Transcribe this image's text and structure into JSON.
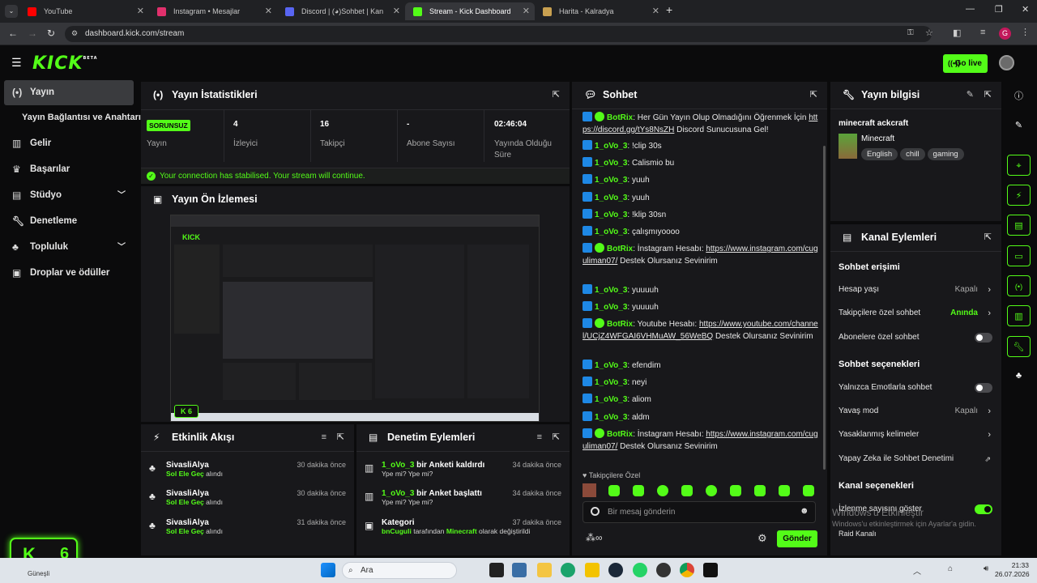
{
  "browser": {
    "tabs": [
      {
        "label": "YouTube",
        "color": "#ff0000"
      },
      {
        "label": "Instagram • Mesajlar",
        "color": "#e1306c"
      },
      {
        "label": "Discord | (◕)Sohbet | Kan",
        "color": "#5865f2"
      },
      {
        "label": "Stream - Kick Dashboard",
        "color": "#53fc18"
      },
      {
        "label": "Harita - Kalradya",
        "color": "#c8a050"
      }
    ],
    "url": "dashboard.kick.com/stream",
    "profile_letter": "G"
  },
  "header": {
    "logo": "KICK",
    "logo_sup": "BETA",
    "go_live": "Go live"
  },
  "sidebar": {
    "items": [
      {
        "label": "Yayın",
        "icon": "broadcast-icon"
      },
      {
        "label": "Yayın Bağlantısı ve Anahtarı",
        "icon": ""
      },
      {
        "label": "Gelir",
        "icon": "chart-icon"
      },
      {
        "label": "Başarılar",
        "icon": "trophy-icon"
      },
      {
        "label": "Stüdyo",
        "icon": "studio-icon"
      },
      {
        "label": "Denetleme",
        "icon": "wrench-icon"
      },
      {
        "label": "Topluluk",
        "icon": "community-icon"
      },
      {
        "label": "Droplar ve ödüller",
        "icon": "gift-icon"
      }
    ],
    "kick_badge_count": "6"
  },
  "stats": {
    "title": "Yayın İstatistikleri",
    "status_badge": "SORUNSUZ",
    "status_label": "Yayın",
    "items": [
      {
        "value": "4",
        "label": "İzleyici"
      },
      {
        "value": "16",
        "label": "Takipçi"
      },
      {
        "value": "-",
        "label": "Abone Sayısı"
      },
      {
        "value": "02:46:04",
        "label": "Yayında Olduğu Süre"
      }
    ],
    "notice": "Your connection has stabilised. Your stream will continue."
  },
  "preview": {
    "title": "Yayın Ön İzlemesi",
    "viewers": "6"
  },
  "activity": {
    "title": "Etkinlik Akışı",
    "items": [
      {
        "name": "SivasliAlya",
        "sub": "Sol Ele Geç",
        "suffix": "alındı",
        "time": "30 dakika önce"
      },
      {
        "name": "SivasliAlya",
        "sub": "Sol Ele Geç",
        "suffix": "alındı",
        "time": "30 dakika önce"
      },
      {
        "name": "SivasliAlya",
        "sub": "Sol Ele Geç",
        "suffix": "alındı",
        "time": "31 dakika önce"
      }
    ]
  },
  "moderation": {
    "title": "Denetim Eylemleri",
    "items": [
      {
        "user": "1_oVo_3",
        "action": "bir Anketi kaldırdı",
        "detail": "Ype mi? Ype mi?",
        "time": "34 dakika önce"
      },
      {
        "user": "1_oVo_3",
        "action": "bir Anket başlattı",
        "detail": "Ype mi? Ype mi?",
        "time": "34 dakika önce"
      },
      {
        "user": "Kategori",
        "action": "",
        "detail_user": "bnCuguli",
        "detail_mid": "tarafından",
        "detail_game": "Minecraft",
        "detail_end": "olarak değiştirildi",
        "time": "37 dakika önce"
      }
    ]
  },
  "chat": {
    "title": "Sohbet",
    "messages": [
      {
        "user": "BotRix",
        "verified": true,
        "text": "Her Gün Yayın Olup Olmadığını Öğrenmek İçin",
        "link": "https://discord.gg/tYs8NsZH",
        "after": "Discord Sunucusuna Gel!"
      },
      {
        "user": "1_oVo_3",
        "text": "!clip 30s"
      },
      {
        "user": "1_oVo_3",
        "text": "Calismio bu"
      },
      {
        "user": "1_oVo_3",
        "text": "yuuh"
      },
      {
        "user": "1_oVo_3",
        "text": "yuuh"
      },
      {
        "user": "1_oVo_3",
        "text": "!klip 30sn"
      },
      {
        "user": "1_oVo_3",
        "text": "çalışmıyoooo"
      },
      {
        "user": "BotRix",
        "verified": true,
        "text": "İnstagram Hesabı:",
        "link": "https://www.instagram.com/cuguliman07/",
        "after": "Destek Olursanız Sevinirim"
      },
      {
        "user": "1_oVo_3",
        "text": "yuuuuh"
      },
      {
        "user": "1_oVo_3",
        "text": "yuuuuh"
      },
      {
        "user": "BotRix",
        "verified": true,
        "text": "Youtube Hesabı:",
        "link": "https://www.youtube.com/channel/UCjZ4WFGAI6VHMuAW_56WeBQ",
        "after": "Destek Olursanız Sevinirim"
      },
      {
        "user": "1_oVo_3",
        "text": "efendim"
      },
      {
        "user": "1_oVo_3",
        "text": "neyi"
      },
      {
        "user": "1_oVo_3",
        "text": "aliom"
      },
      {
        "user": "1_oVo_3",
        "text": "aldm"
      },
      {
        "user": "BotRix",
        "verified": true,
        "text": "İnstagram Hesabı:",
        "link": "https://www.instagram.com/cuguliman07/",
        "after": "Destek Olursanız Sevinirim"
      }
    ],
    "followers_only": "Takipçilere Özel",
    "input_placeholder": "Bir mesaj gönderin",
    "send": "Gönder"
  },
  "stream_info": {
    "title": "Yayın bilgisi",
    "stream_title": "minecraft ackcraft",
    "category": "Minecraft",
    "tags": [
      "English",
      "chill",
      "gaming"
    ]
  },
  "channel_actions": {
    "title": "Kanal Eylemleri",
    "chat_access_title": "Sohbet erişimi",
    "rows_access": [
      {
        "label": "Hesap yaşı",
        "value": "Kapalı"
      },
      {
        "label": "Takipçilere özel sohbet",
        "value": "Anında"
      },
      {
        "label": "Abonelere özel sohbet",
        "value": ""
      }
    ],
    "chat_options_title": "Sohbet seçenekleri",
    "rows_options": [
      {
        "label": "Yalnızca Emotlarla sohbet",
        "value": ""
      },
      {
        "label": "Yavaş mod",
        "value": "Kapalı"
      },
      {
        "label": "Yasaklanmış kelimeler",
        "value": ""
      },
      {
        "label": "Yapay Zeka ile Sohbet Denetimi",
        "value": ""
      }
    ],
    "channel_options_title": "Kanal seçenekleri",
    "rows_channel": [
      {
        "label": "İzlenme sayısını göster",
        "value": ""
      },
      {
        "label": "Raid Kanalı",
        "value": ""
      }
    ]
  },
  "windows": {
    "activate_title": "Windows'u Etkinleştir",
    "activate_sub": "Windows'u etkinleştirmek için Ayarlar'a gidin.",
    "search": "Ara",
    "weather": "Güneşli",
    "time": "21:33",
    "date": "26.07.2026"
  }
}
